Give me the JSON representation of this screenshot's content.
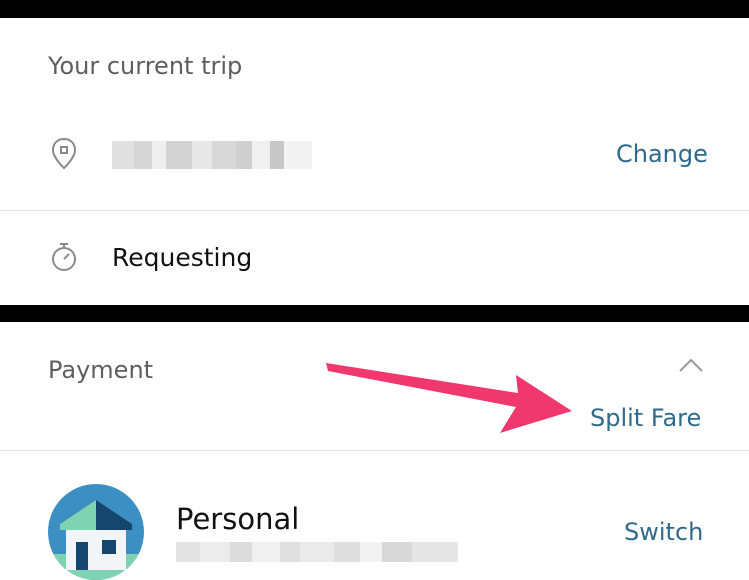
{
  "trip": {
    "title": "Your current trip",
    "change_label": "Change",
    "status": "Requesting"
  },
  "payment": {
    "title": "Payment",
    "split_fare_label": "Split Fare",
    "profile_name": "Personal",
    "switch_label": "Switch"
  },
  "icons": {
    "location": "location-pin-icon",
    "timer": "stopwatch-icon",
    "collapse": "chevron-up-icon",
    "avatar": "house-icon"
  },
  "colors": {
    "link": "#2f6a8c",
    "annotation_arrow": "#f0376e",
    "avatar_bg": "#3b8fc3"
  }
}
